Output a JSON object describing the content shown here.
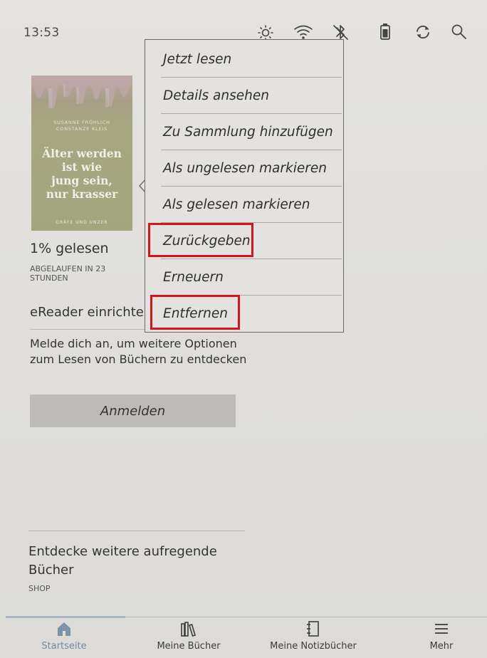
{
  "status_bar": {
    "time": "13:53",
    "icons": [
      "brightness-icon",
      "wifi-icon",
      "bluetooth-off-icon",
      "battery-icon",
      "sync-icon",
      "search-icon"
    ]
  },
  "book": {
    "cover": {
      "authors": [
        "SUSANNE FRÖHLICH",
        "CONSTANZE KLEIS"
      ],
      "title_lines": [
        "Älter werden",
        "ist wie",
        "jung sein,",
        "nur krasser"
      ],
      "publisher": "GRÄFE UND UNZER"
    },
    "progress": "1% gelesen",
    "expiry": "ABGELAUFEN IN 23 STUNDEN"
  },
  "setup": {
    "title": "eReader einrichten",
    "description": "Melde dich an, um weitere Optionen zum Lesen von Büchern zu entdecken",
    "login_label": "Anmelden"
  },
  "shop": {
    "title": "Entdecke weitere aufregende Bücher",
    "subtitle": "SHOP"
  },
  "context_menu": {
    "items": [
      {
        "label": "Jetzt lesen"
      },
      {
        "label": "Details ansehen"
      },
      {
        "label": "Zu Sammlung hinzufügen"
      },
      {
        "label": "Als ungelesen markieren"
      },
      {
        "label": "Als gelesen markieren"
      },
      {
        "label": "Zurückgeben",
        "highlighted": true
      },
      {
        "label": "Erneuern"
      },
      {
        "label": "Entfernen",
        "highlighted": true
      }
    ],
    "highlight_color": "#d4161a"
  },
  "bottom_nav": {
    "items": [
      {
        "label": "Startseite",
        "icon": "home-icon",
        "active": true
      },
      {
        "label": "Meine Bücher",
        "icon": "books-icon"
      },
      {
        "label": "Meine Notizbücher",
        "icon": "notebook-icon"
      },
      {
        "label": "Mehr",
        "icon": "menu-icon"
      }
    ],
    "active_color": "#6f8aa6"
  }
}
